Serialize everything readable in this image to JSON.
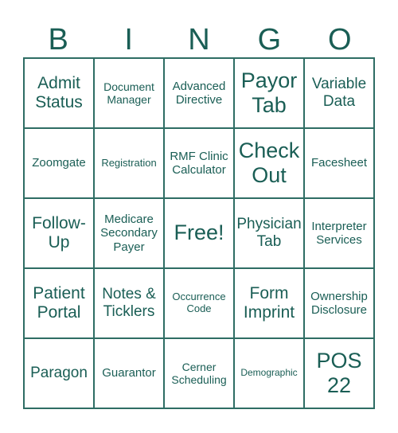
{
  "header": [
    "B",
    "I",
    "N",
    "G",
    "O"
  ],
  "cells": [
    {
      "text": "Admit Status",
      "size": "s-l"
    },
    {
      "text": "Document Manager",
      "size": "s-xs"
    },
    {
      "text": "Advanced Directive",
      "size": "s-sm"
    },
    {
      "text": "Payor Tab",
      "size": "s-xl"
    },
    {
      "text": "Variable Data",
      "size": "s-m"
    },
    {
      "text": "Zoomgate",
      "size": "s-sm"
    },
    {
      "text": "Registration",
      "size": "s-xxs"
    },
    {
      "text": "RMF Clinic Calculator",
      "size": "s-sm"
    },
    {
      "text": "Check Out",
      "size": "s-xl"
    },
    {
      "text": "Facesheet",
      "size": "s-sm"
    },
    {
      "text": "Follow-Up",
      "size": "s-l"
    },
    {
      "text": "Medicare Secondary Payer",
      "size": "s-sm"
    },
    {
      "text": "Free!",
      "size": "s-xl"
    },
    {
      "text": "Physician Tab",
      "size": "s-m"
    },
    {
      "text": "Interpreter Services",
      "size": "s-sm"
    },
    {
      "text": "Patient Portal",
      "size": "s-l"
    },
    {
      "text": "Notes & Ticklers",
      "size": "s-m"
    },
    {
      "text": "Occurrence Code",
      "size": "s-xxs"
    },
    {
      "text": "Form Imprint",
      "size": "s-l"
    },
    {
      "text": "Ownership Disclosure",
      "size": "s-sm"
    },
    {
      "text": "Paragon",
      "size": "s-m"
    },
    {
      "text": "Guarantor",
      "size": "s-sm"
    },
    {
      "text": "Cerner Scheduling",
      "size": "s-xs"
    },
    {
      "text": "Demographic",
      "size": "s-tiny"
    },
    {
      "text": "POS 22",
      "size": "s-xl"
    }
  ]
}
